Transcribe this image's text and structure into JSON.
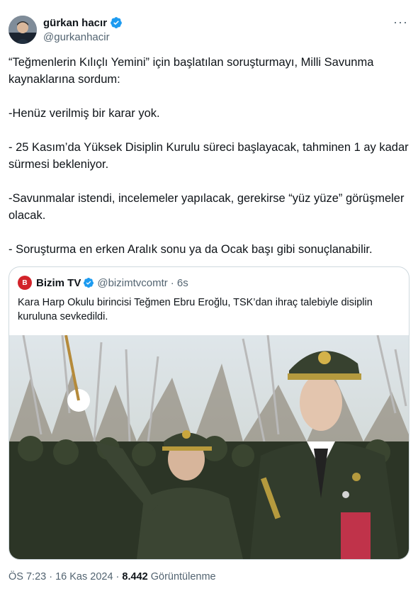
{
  "author": {
    "display_name": "gürkan hacır",
    "handle": "@gurkanhacir",
    "verified_icon": "verified-badge-icon"
  },
  "more_label": "···",
  "tweet": {
    "paragraphs": [
      "“Teğmenlerin Kılıçlı Yemini” için başlatılan soruşturmayı, Milli Savunma kaynaklarına sordum:",
      "-Henüz verilmiş bir karar yok.",
      "- 25 Kasım’da Yüksek Disiplin Kurulu süreci başlayacak, tahminen 1 ay kadar sürmesi bekleniyor.",
      "-Savunmalar istendi, incelemeler yapılacak, gerekirse “yüz yüze” görüşmeler olacak.",
      "- Soruşturma en erken Aralık sonu ya da Ocak başı gibi sonuçlanabilir."
    ]
  },
  "quote": {
    "avatar_text": "B",
    "display_name": "Bizim TV",
    "handle": "@bizimtvcomtr",
    "time": "· 6s",
    "text": "Kara Harp Okulu birincisi Teğmen Ebru Eroğlu, TSK’dan ihraç talebiyle disiplin kuruluna sevkedildi."
  },
  "meta": {
    "time": "ÖS 7:23 · 16 Kas 2024 · ",
    "views_count": "8.442",
    "views_label": " Görüntülenme"
  },
  "colors": {
    "accent": "#1d9bf0",
    "secondary_text": "#536471",
    "border": "#cfd9de",
    "brand_red": "#d2232a"
  }
}
